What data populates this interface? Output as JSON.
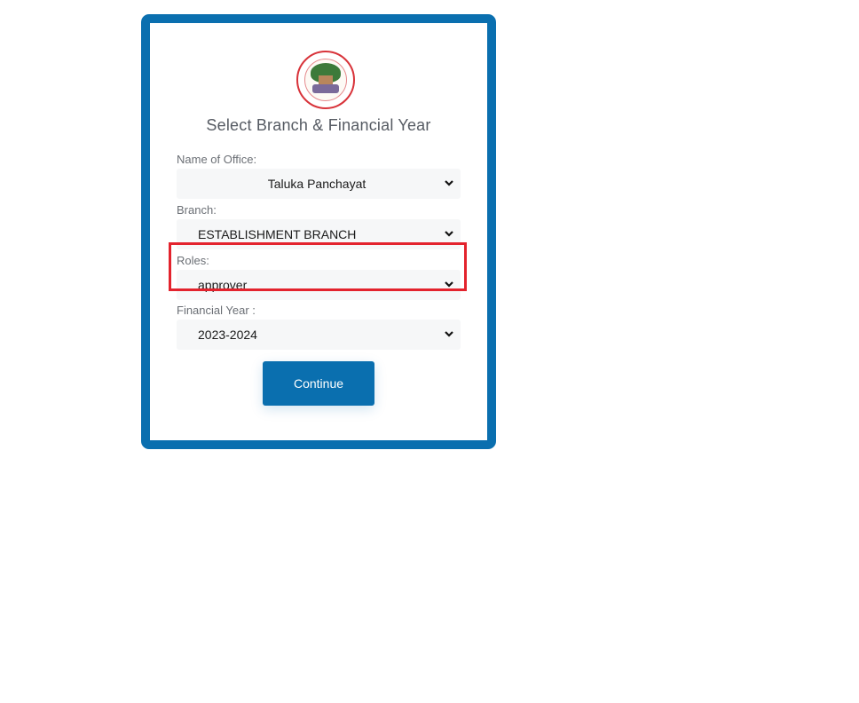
{
  "logo": {
    "icon": "emblem-logo",
    "alt": "Panchayati Raj Accounting Information System for Automation emblem"
  },
  "form": {
    "title": "Select Branch & Financial Year",
    "fields": [
      {
        "label": "Name of Office:",
        "value": "Taluka Panchayat"
      },
      {
        "label": "Branch:",
        "value": "ESTABLISHMENT BRANCH"
      },
      {
        "label": "Roles:",
        "value": "approver"
      },
      {
        "label": "Financial Year :",
        "value": "2023-2024"
      }
    ],
    "continue_label": "Continue"
  },
  "colors": {
    "accent": "#0a6faf",
    "highlight": "#e3232d"
  }
}
